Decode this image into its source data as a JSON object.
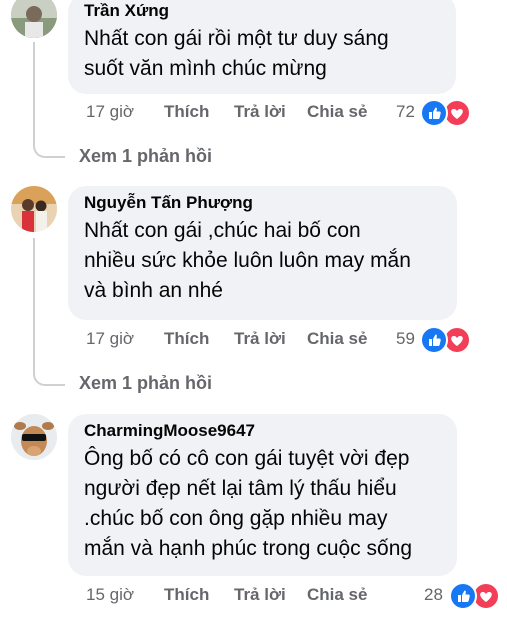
{
  "comments": [
    {
      "author": "Trần Xứng",
      "lines": [
        "Nhất con gái rồi một tư duy sáng",
        "suốt văn mình chúc mừng"
      ],
      "time": "17 giờ",
      "like_label": "Thích",
      "reply_label": "Trả lời",
      "share_label": "Chia sẻ",
      "reaction_count": "72",
      "view_replies": "Xem 1 phản hồi"
    },
    {
      "author": "Nguyễn Tấn Phượng",
      "lines": [
        "Nhất con gái ,chúc hai bố con",
        "nhiều sức khỏe luôn luôn may mắn",
        "và bình an nhé"
      ],
      "time": "17 giờ",
      "like_label": "Thích",
      "reply_label": "Trả lời",
      "share_label": "Chia sẻ",
      "reaction_count": "59",
      "view_replies": "Xem 1 phản hồi"
    },
    {
      "author": "CharmingMoose9647",
      "lines": [
        "Ông bố có cô con gái tuyệt vời đẹp",
        "người đẹp nết lại tâm lý thấu hiểu",
        ".chúc bố con ông gặp nhiều may",
        "mắn và hạnh phúc trong cuộc sống"
      ],
      "time": "15 giờ",
      "like_label": "Thích",
      "reply_label": "Trả lời",
      "share_label": "Chia sẻ",
      "reaction_count": "28"
    }
  ],
  "colors": {
    "like_blue": "#1877f2",
    "love_red": "#f33e58",
    "bubble_bg": "#f0f2f5",
    "meta_gray": "#65676b"
  }
}
